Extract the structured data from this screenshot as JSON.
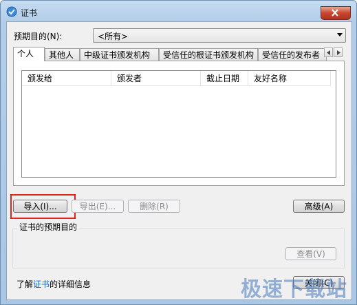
{
  "window": {
    "title": "证书"
  },
  "purpose": {
    "label": "预期目的(N):",
    "selected": "<所有>"
  },
  "tabs": [
    {
      "label": "个人"
    },
    {
      "label": "其他人"
    },
    {
      "label": "中级证书颁发机构"
    },
    {
      "label": "受信任的根证书颁发机构"
    },
    {
      "label": "受信任的发布者"
    }
  ],
  "list": {
    "columns": [
      {
        "label": "颁发给"
      },
      {
        "label": "颁发者"
      },
      {
        "label": "截止日期"
      },
      {
        "label": "友好名称"
      }
    ],
    "rows": []
  },
  "buttons": {
    "import": "导入(I)...",
    "export": "导出(E)...",
    "remove": "删除(R)",
    "advanced": "高级(A)",
    "view": "查看(V)",
    "close": "关闭(C)"
  },
  "group": {
    "label": "证书的预期目的"
  },
  "footer": {
    "prefix": "了解",
    "link": "证书",
    "suffix": "的详细信息"
  },
  "watermark": "极速下载站",
  "colors": {
    "highlight_box": "#e2231a",
    "link": "#0066cc"
  }
}
